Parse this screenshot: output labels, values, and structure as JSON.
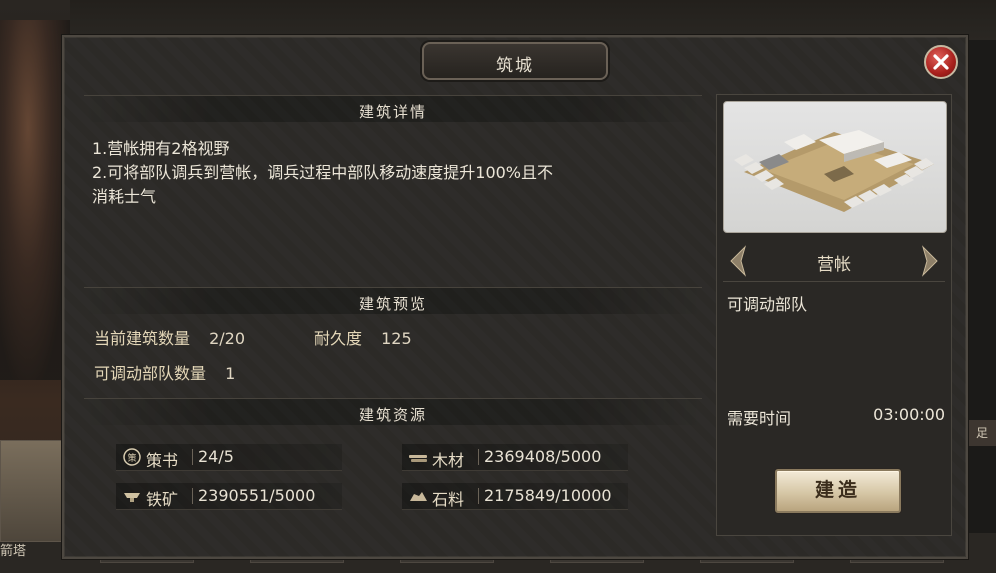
{
  "dialog": {
    "title": "筑城"
  },
  "details": {
    "header": "建筑详情",
    "lines": [
      "1.营帐拥有2格视野",
      "2.可将部队调兵到营帐，调兵过程中部队移动速度提升100%且不",
      "消耗士气"
    ]
  },
  "preview": {
    "header": "建筑预览",
    "count_label": "当前建筑数量",
    "count_value": "2/20",
    "durability_label": "耐久度",
    "durability_value": "125",
    "troops_label": "可调动部队数量",
    "troops_value": "1"
  },
  "resources": {
    "header": "建筑资源",
    "items": [
      {
        "name": "策书",
        "value": "24/5",
        "icon": "strategy-book-icon"
      },
      {
        "name": "木材",
        "value": "2369408/5000",
        "icon": "wood-icon"
      },
      {
        "name": "铁矿",
        "value": "2390551/5000",
        "icon": "iron-icon"
      },
      {
        "name": "石料",
        "value": "2175849/10000",
        "icon": "stone-icon"
      }
    ]
  },
  "building": {
    "name": "营帐",
    "description": "可调动部队",
    "time_label": "需要时间",
    "time_value": "03:00:00",
    "build_button": "建造"
  },
  "background": {
    "left_label": "箭塔",
    "right_tab": "足"
  },
  "colors": {
    "close_button": "#a8201c",
    "build_button": "#d6c7a6"
  }
}
